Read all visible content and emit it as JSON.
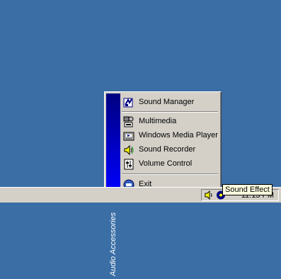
{
  "menu": {
    "banner_title": "Audio Accessories",
    "items": [
      {
        "label": "Sound Manager",
        "icon": "sound-manager-icon"
      },
      {
        "label": "Multimedia",
        "icon": "multimedia-icon"
      },
      {
        "label": "Windows Media Player",
        "icon": "media-player-icon"
      },
      {
        "label": "Sound Recorder",
        "icon": "sound-recorder-icon"
      },
      {
        "label": "Volume Control",
        "icon": "volume-control-icon"
      },
      {
        "label": "Exit",
        "icon": "exit-icon"
      }
    ]
  },
  "taskbar": {
    "clock": "11:13 PM"
  },
  "tooltip": {
    "text": "Sound Effect"
  },
  "colors": {
    "desktop": "#3a6ea5",
    "banner": "#000080",
    "face": "#d4d0c8"
  }
}
